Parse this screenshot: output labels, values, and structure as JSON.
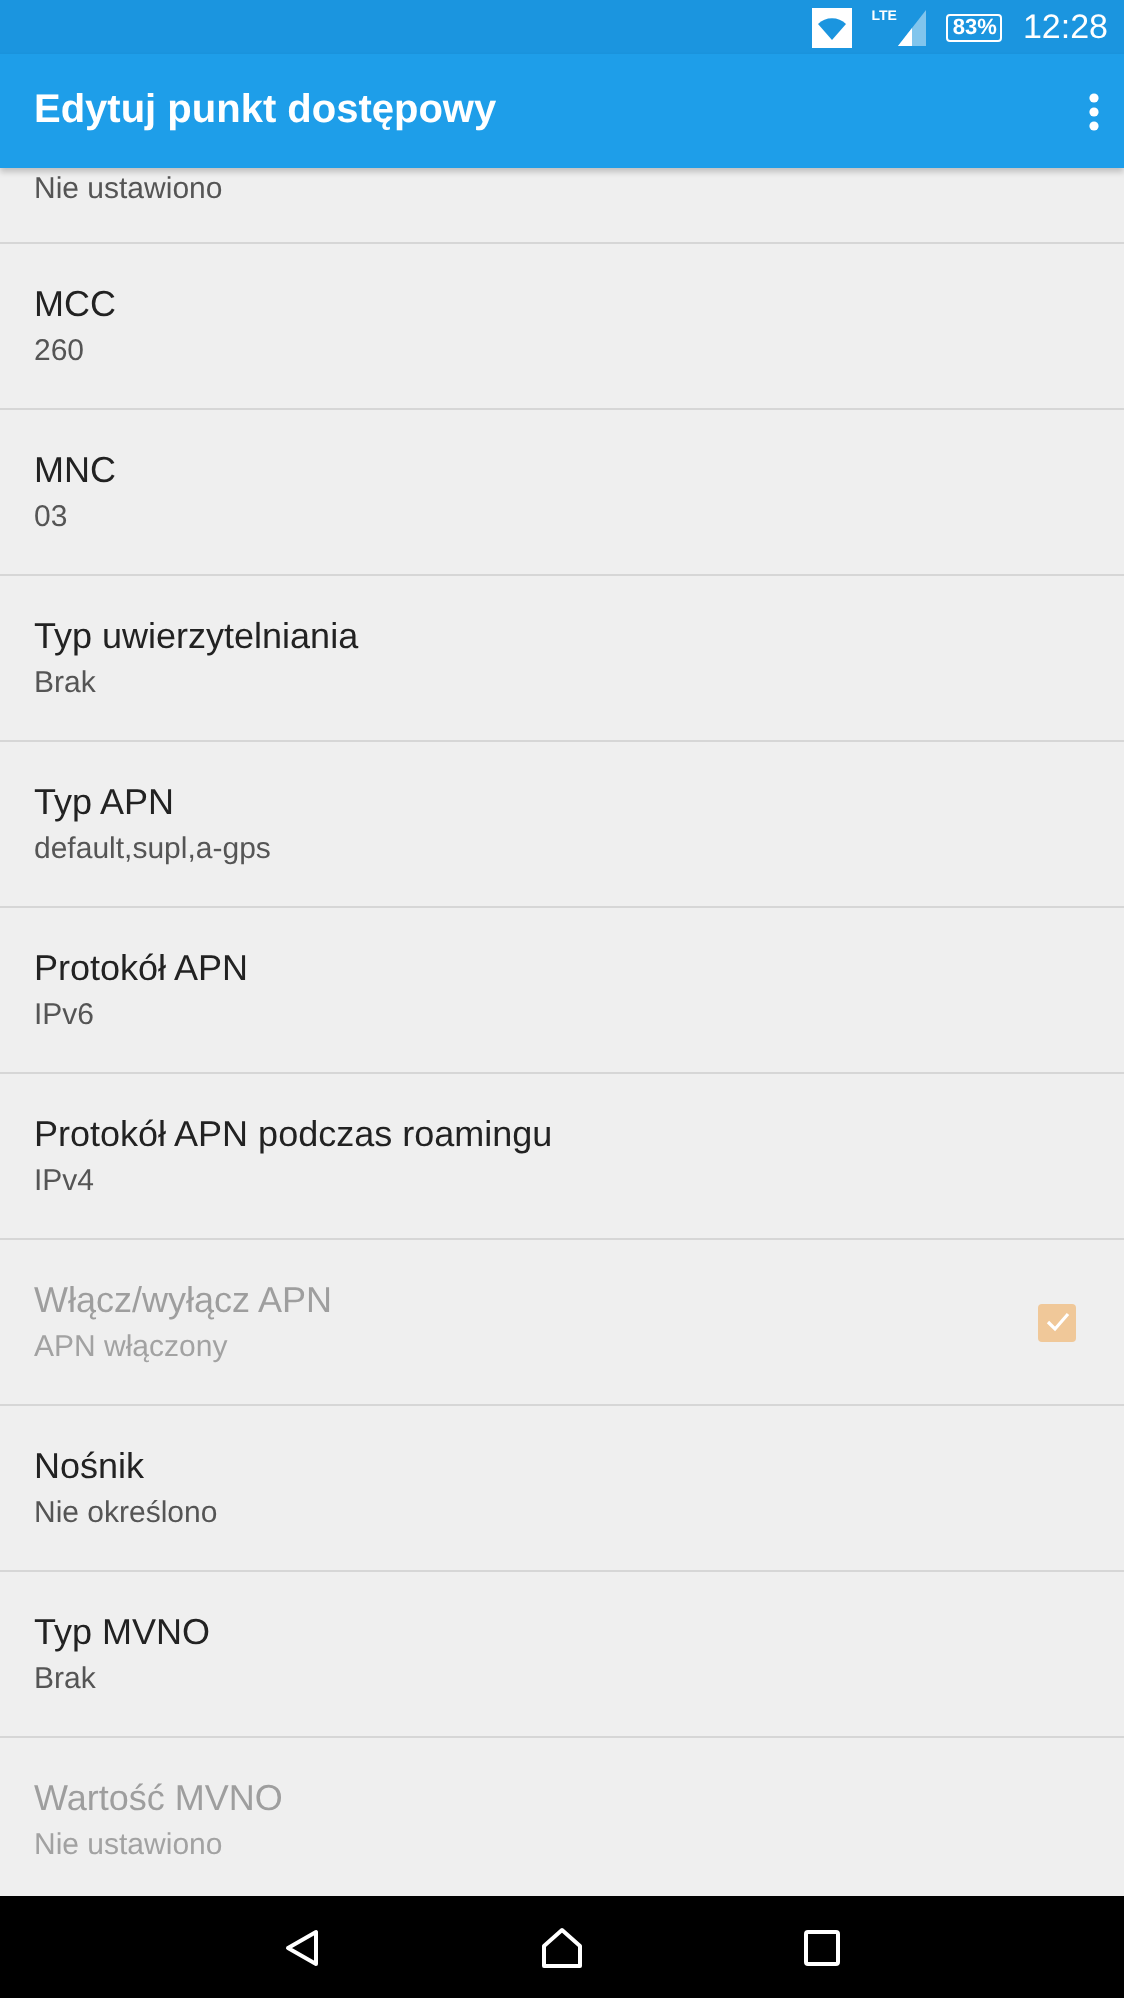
{
  "status_bar": {
    "battery": "83%",
    "network": "LTE",
    "time": "12:28"
  },
  "toolbar": {
    "title": "Edytuj punkt dostępowy"
  },
  "partial_item": {
    "summary": "Nie ustawiono"
  },
  "items": [
    {
      "title": "MCC",
      "summary": "260",
      "disabled": false
    },
    {
      "title": "MNC",
      "summary": "03",
      "disabled": false
    },
    {
      "title": "Typ uwierzytelniania",
      "summary": "Brak",
      "disabled": false
    },
    {
      "title": "Typ APN",
      "summary": "default,supl,a-gps",
      "disabled": false
    },
    {
      "title": "Protokół APN",
      "summary": "IPv6",
      "disabled": false
    },
    {
      "title": "Protokół APN podczas roamingu",
      "summary": "IPv4",
      "disabled": false
    },
    {
      "title": "Włącz/wyłącz APN",
      "summary": "APN włączony",
      "disabled": true,
      "kind": "checkbox",
      "checked": true
    },
    {
      "title": "Nośnik",
      "summary": "Nie określono",
      "disabled": false
    },
    {
      "title": "Typ MVNO",
      "summary": "Brak",
      "disabled": false
    },
    {
      "title": "Wartość MVNO",
      "summary": "Nie ustawiono",
      "disabled": true
    }
  ]
}
